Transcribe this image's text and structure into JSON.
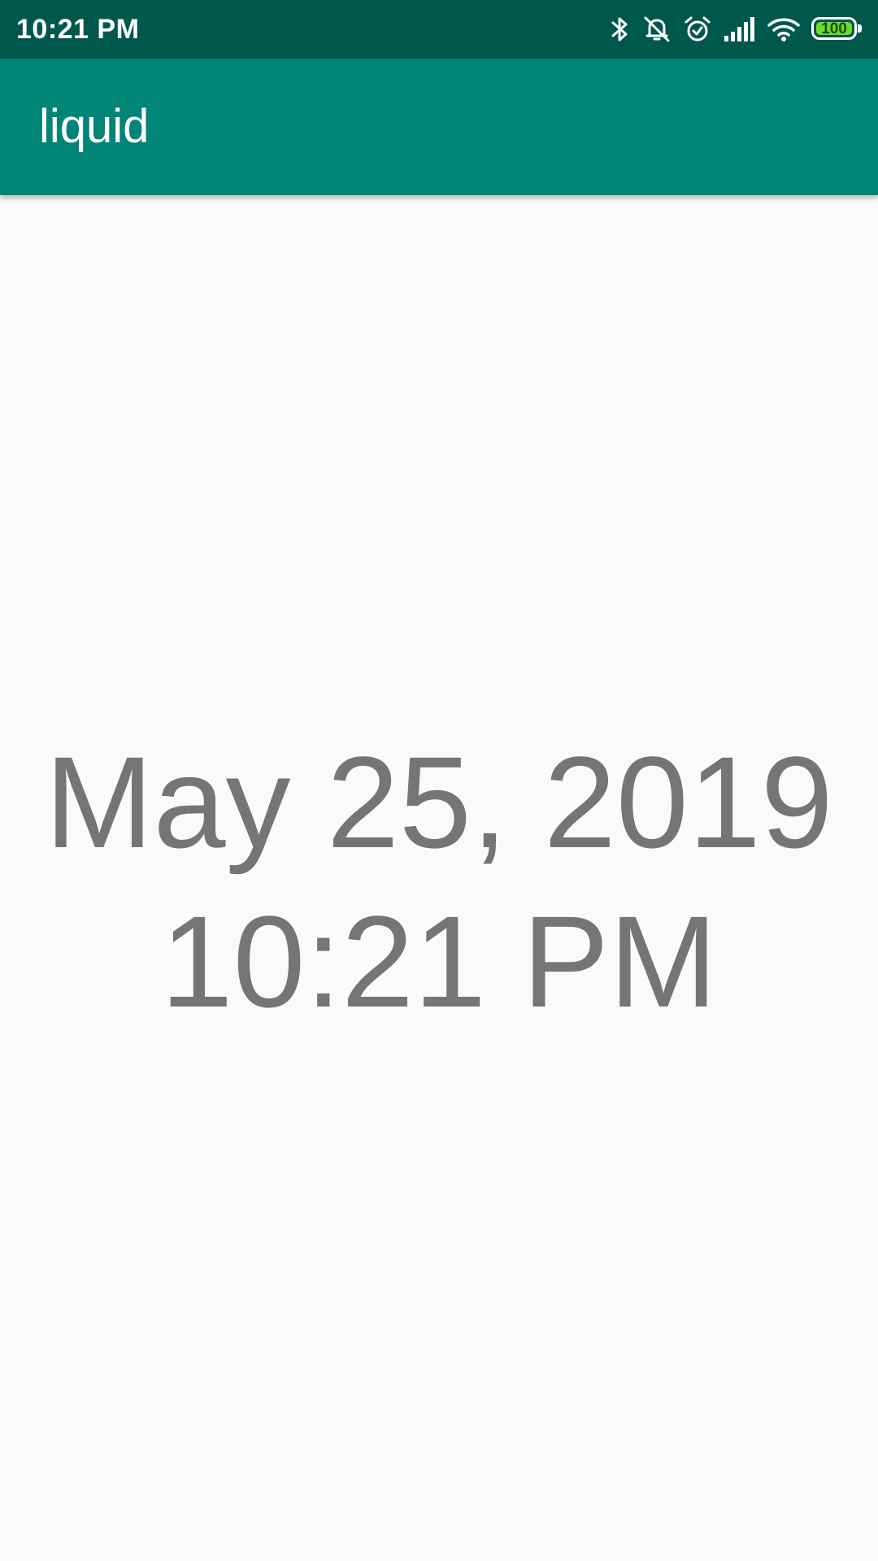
{
  "status_bar": {
    "time": "10:21 PM",
    "battery_level": "100",
    "icons": [
      "bluetooth-icon",
      "notifications-off-icon",
      "alarm-icon",
      "cell-signal-icon",
      "wifi-icon",
      "battery-icon"
    ],
    "background_color": "#00574b"
  },
  "app_bar": {
    "title": "liquid",
    "background_color": "#008577"
  },
  "main": {
    "date": "May 25, 2019",
    "time": "10:21 PM",
    "text_color": "#757575",
    "background_color": "#fafafa"
  }
}
